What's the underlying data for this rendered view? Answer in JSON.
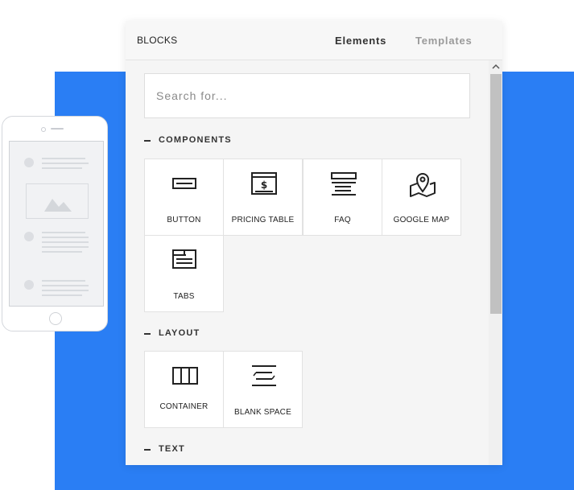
{
  "panel": {
    "title": "BLOCKS",
    "tabs": [
      {
        "label": "Elements",
        "active": true
      },
      {
        "label": "Templates",
        "active": false
      }
    ]
  },
  "search": {
    "placeholder": "Search for..."
  },
  "sections": [
    {
      "label": "COMPONENTS",
      "items": [
        {
          "label": "BUTTON",
          "icon": "button-icon"
        },
        {
          "label": "PRICING TABLE",
          "icon": "pricing-table-icon"
        },
        {
          "label": "FAQ",
          "icon": "faq-icon"
        },
        {
          "label": "GOOGLE MAP",
          "icon": "map-pin-icon"
        },
        {
          "label": "TABS",
          "icon": "tabs-icon"
        }
      ]
    },
    {
      "label": "LAYOUT",
      "items": [
        {
          "label": "CONTAINER",
          "icon": "container-icon"
        },
        {
          "label": "BLANK SPACE",
          "icon": "blank-space-icon"
        }
      ]
    },
    {
      "label": "TEXT",
      "items": []
    }
  ],
  "colors": {
    "accent_blue": "#2a7ef4",
    "panel_bg": "#f5f5f5",
    "tab_inactive": "#9a9a9a"
  }
}
